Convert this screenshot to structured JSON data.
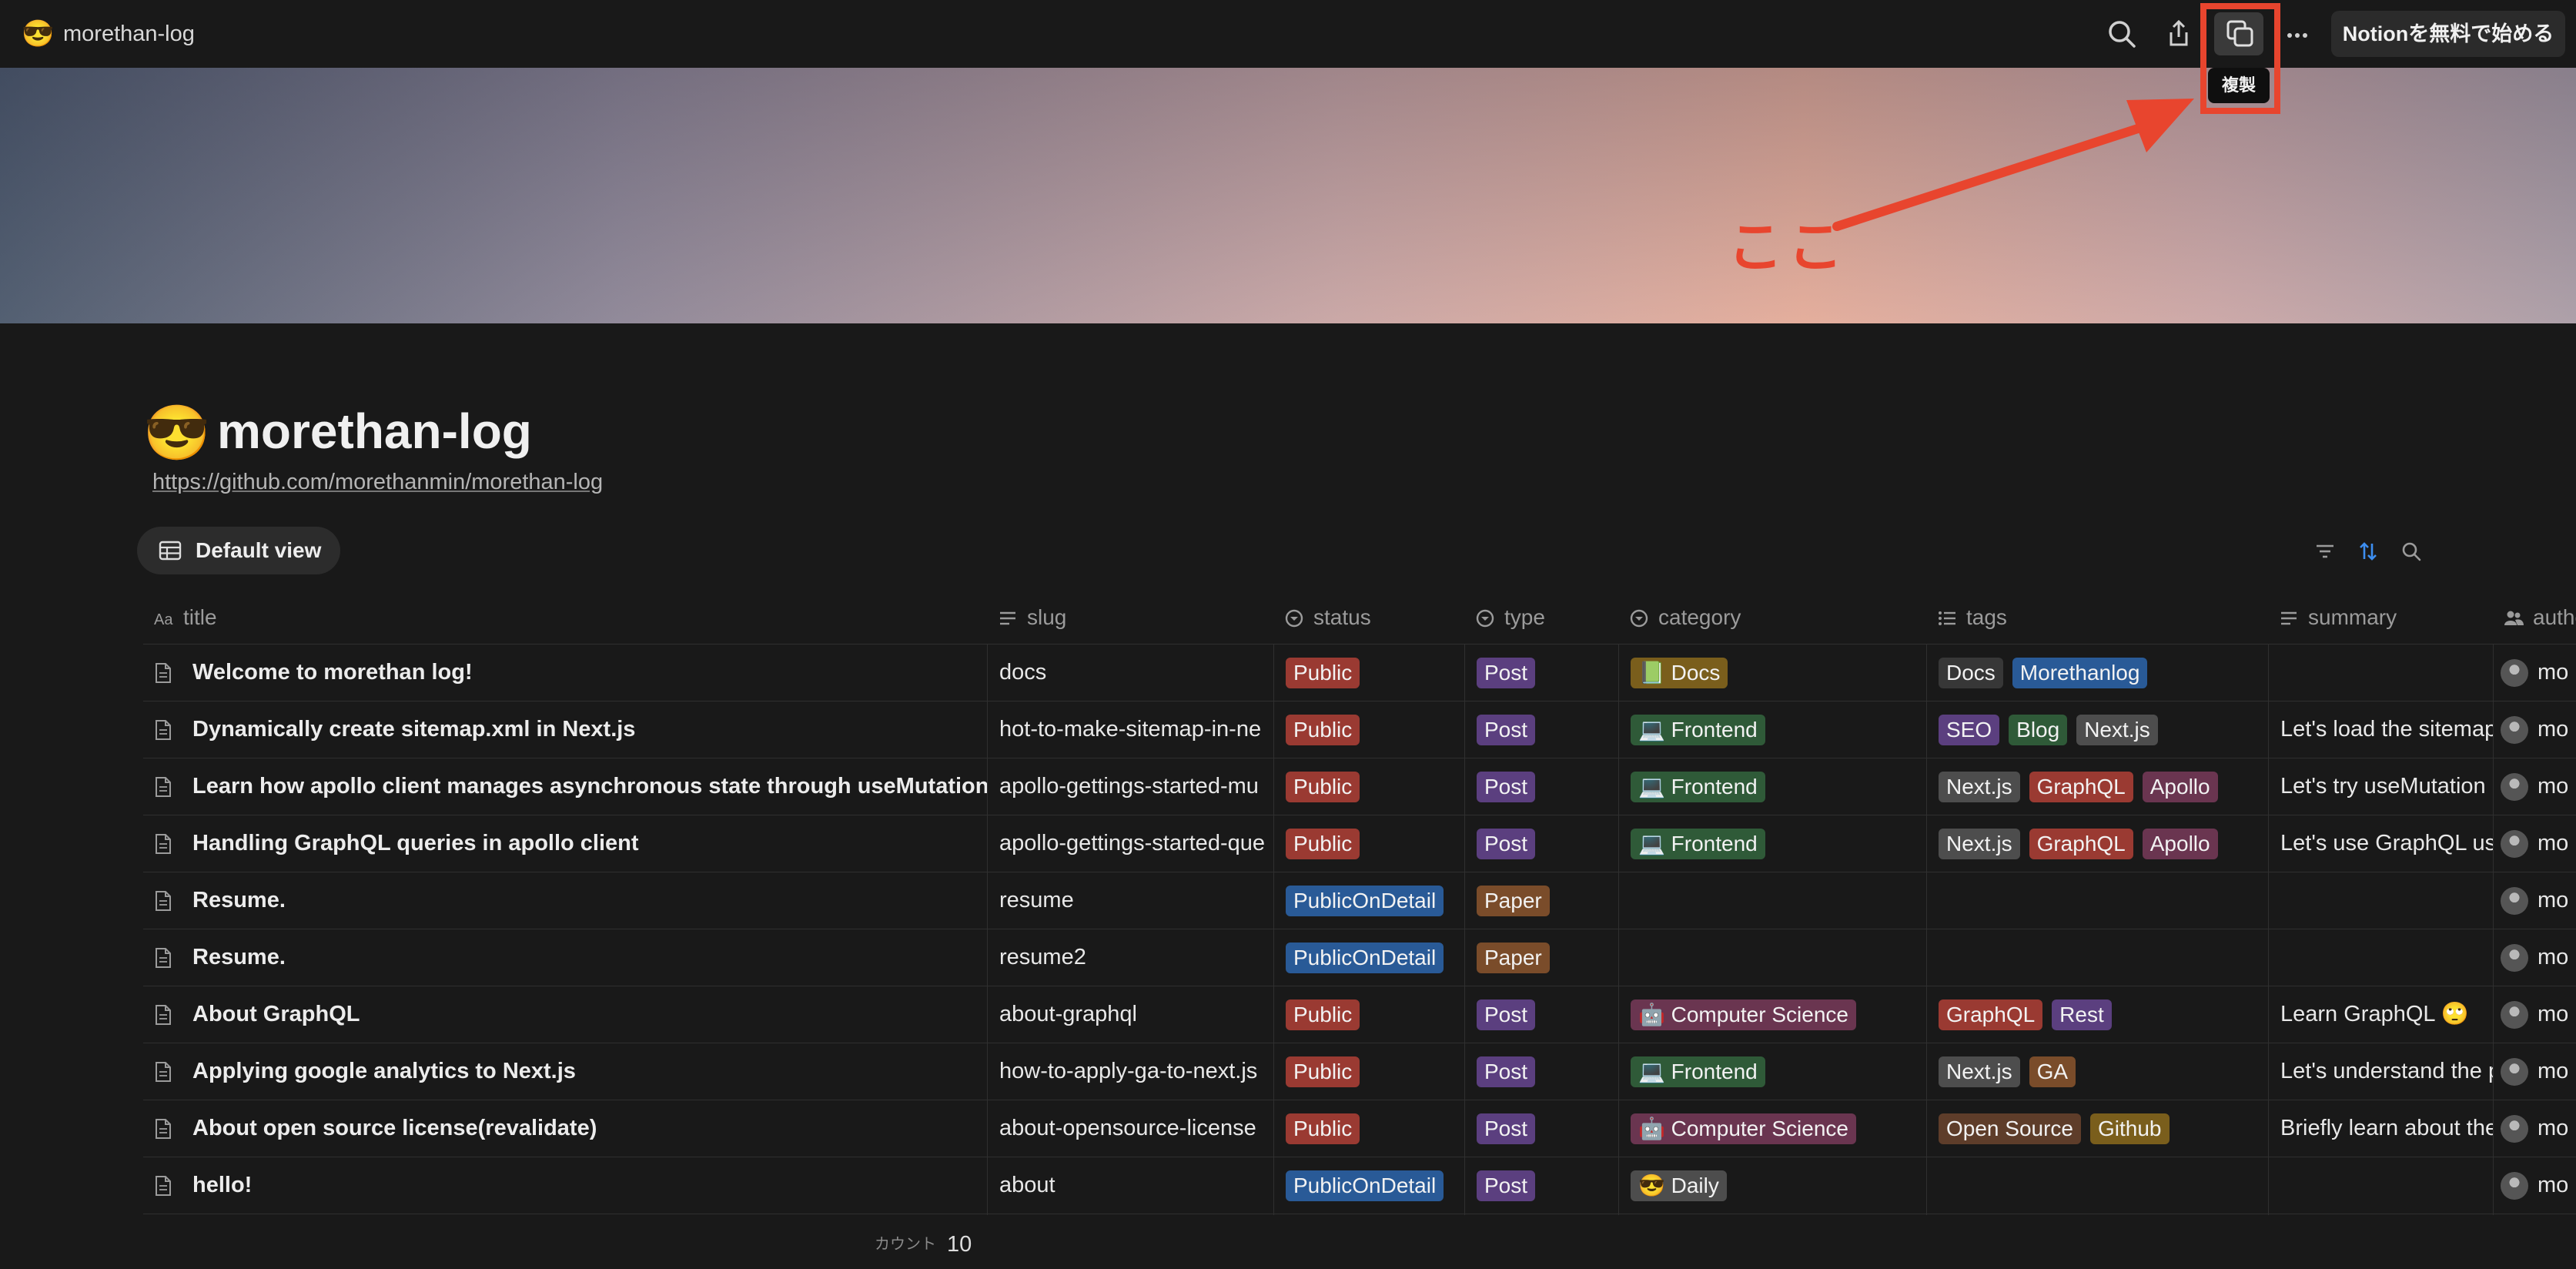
{
  "topbar": {
    "emoji": "😎",
    "title": "morethan-log",
    "cta_label": "Notionを無料で始める",
    "tooltip": "複製",
    "icons": [
      "search-icon",
      "share-icon",
      "duplicate-icon",
      "more-icon"
    ]
  },
  "annotation": {
    "text": "ここ",
    "color": "#e8452e"
  },
  "page": {
    "emoji": "😎",
    "title": "morethan-log",
    "link": "https://github.com/morethanmin/morethan-log"
  },
  "view": {
    "label": "Default view",
    "tools": [
      "filter-icon",
      "sort-icon",
      "search-icon"
    ]
  },
  "table": {
    "columns": [
      {
        "label": "title",
        "icon": "text-type-icon"
      },
      {
        "label": "slug",
        "icon": "text-lines-icon"
      },
      {
        "label": "status",
        "icon": "select-icon"
      },
      {
        "label": "type",
        "icon": "select-icon"
      },
      {
        "label": "category",
        "icon": "select-icon"
      },
      {
        "label": "tags",
        "icon": "list-icon"
      },
      {
        "label": "summary",
        "icon": "text-lines-icon"
      },
      {
        "label": "author",
        "icon": "people-icon"
      }
    ],
    "rows": [
      {
        "title": "Welcome to morethan log!",
        "slug": "docs",
        "status": "Public",
        "type": "Post",
        "category": "📗 Docs",
        "tags": [
          "Docs",
          "Morethanlog"
        ],
        "summary": "",
        "author": "mo"
      },
      {
        "title": "Dynamically create sitemap.xml in Next.js",
        "slug": "hot-to-make-sitemap-in-ne",
        "status": "Public",
        "type": "Post",
        "category": "💻 Frontend",
        "tags": [
          "SEO",
          "Blog",
          "Next.js"
        ],
        "summary": "Let's load the sitemap",
        "author": "mo"
      },
      {
        "title": "Learn how apollo client manages asynchronous state through useMutation",
        "slug": "apollo-gettings-started-mu",
        "status": "Public",
        "type": "Post",
        "category": "💻 Frontend",
        "tags": [
          "Next.js",
          "GraphQL",
          "Apollo"
        ],
        "summary": "Let's try useMutation",
        "author": "mo"
      },
      {
        "title": "Handling GraphQL queries in apollo client",
        "slug": "apollo-gettings-started-que",
        "status": "Public",
        "type": "Post",
        "category": "💻 Frontend",
        "tags": [
          "Next.js",
          "GraphQL",
          "Apollo"
        ],
        "summary": "Let's use GraphQL us",
        "author": "mo"
      },
      {
        "title": "Resume.",
        "slug": "resume",
        "status": "PublicOnDetail",
        "type": "Paper",
        "category": "",
        "tags": [],
        "summary": "",
        "author": "mo"
      },
      {
        "title": "Resume.",
        "slug": "resume2",
        "status": "PublicOnDetail",
        "type": "Paper",
        "category": "",
        "tags": [],
        "summary": "",
        "author": "mo"
      },
      {
        "title": "About GraphQL",
        "slug": "about-graphql",
        "status": "Public",
        "type": "Post",
        "category": "🤖 Computer Science",
        "tags": [
          "GraphQL",
          "Rest"
        ],
        "summary": "Learn GraphQL 🙄",
        "author": "mo"
      },
      {
        "title": "Applying google analytics to Next.js",
        "slug": "how-to-apply-ga-to-next.js",
        "status": "Public",
        "type": "Post",
        "category": "💻 Frontend",
        "tags": [
          "Next.js",
          "GA"
        ],
        "summary": "Let's understand the p",
        "author": "mo"
      },
      {
        "title": "About open source license(revalidate)",
        "slug": "about-opensource-license",
        "status": "Public",
        "type": "Post",
        "category": "🤖 Computer Science",
        "tags": [
          "Open Source",
          "Github"
        ],
        "summary": "Briefly learn about the",
        "author": "mo"
      },
      {
        "title": "hello!",
        "slug": "about",
        "status": "PublicOnDetail",
        "type": "Post",
        "category": "😎 Daily",
        "tags": [],
        "summary": "",
        "author": "mo"
      }
    ],
    "count_label": "カウント",
    "count_value": "10"
  },
  "tag_colors": {
    "Public": "#9a3a32",
    "PublicOnDetail": "#295a97",
    "Post": "#5b3f7f",
    "Paper": "#7a4c2a",
    "📗 Docs": "#7a5e1c",
    "💻 Frontend": "#2f5a38",
    "🤖 Computer Science": "#6a3550",
    "😎 Daily": "#4d4d4d",
    "Docs": "#373737",
    "Morethanlog": "#295a97",
    "SEO": "#5b3f7f",
    "Blog": "#2f5a38",
    "Next.js": "#4d4d4d",
    "GraphQL": "#9a3a32",
    "Apollo": "#6a3550",
    "Rest": "#5b3f7f",
    "GA": "#7a4c2a",
    "Open Source": "#5e3d2a",
    "Github": "#7a5e1c"
  }
}
